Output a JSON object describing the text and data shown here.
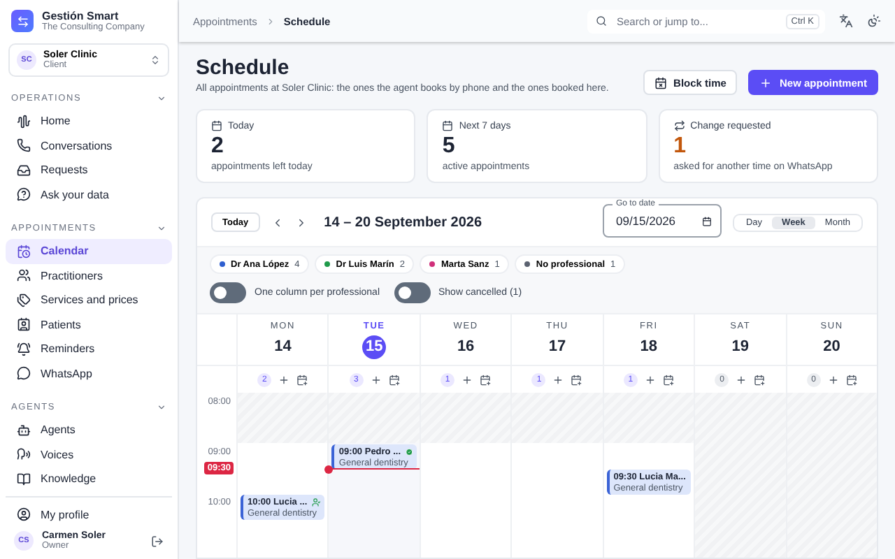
{
  "sidebar": {
    "brand": {
      "name": "Gestión Smart",
      "subtitle": "The Consulting Company"
    },
    "workspace": {
      "initials": "SC",
      "name": "Soler Clinic",
      "role": "Client"
    },
    "sections": [
      {
        "title": "OPERATIONS",
        "expanded": true,
        "items": [
          {
            "label": "Home",
            "selected": false
          },
          {
            "label": "Conversations",
            "selected": false
          },
          {
            "label": "Requests",
            "selected": false
          },
          {
            "label": "Ask your data",
            "selected": false
          }
        ]
      },
      {
        "title": "APPOINTMENTS",
        "expanded": true,
        "items": [
          {
            "label": "Calendar",
            "selected": true
          },
          {
            "label": "Practitioners",
            "selected": false
          },
          {
            "label": "Services and prices",
            "selected": false
          },
          {
            "label": "Patients",
            "selected": false
          },
          {
            "label": "Reminders",
            "selected": false
          },
          {
            "label": "WhatsApp",
            "selected": false
          }
        ]
      },
      {
        "title": "AGENTS",
        "expanded": true,
        "items": [
          {
            "label": "Agents",
            "selected": false
          },
          {
            "label": "Voices",
            "selected": false
          },
          {
            "label": "Knowledge",
            "selected": false
          }
        ]
      }
    ],
    "profile": "My profile",
    "user": {
      "initials": "CS",
      "name": "Carmen Soler",
      "role": "Owner"
    }
  },
  "topbar": {
    "breadcrumb": [
      "Appointments",
      "Schedule"
    ],
    "search": {
      "placeholder": "Search or jump to...",
      "shortcut": "Ctrl K"
    }
  },
  "header": {
    "title": "Schedule",
    "subtitle": "All appointments at Soler Clinic: the ones the agent books by phone and the ones booked here.",
    "buttons": [
      {
        "label": "Block time",
        "kind": "secondary"
      },
      {
        "label": "New appointment",
        "kind": "primary"
      }
    ]
  },
  "stats": [
    {
      "label": "Today",
      "value": "2",
      "caption": "appointments left today",
      "kind": "normal"
    },
    {
      "label": "Next 7 days",
      "value": "5",
      "caption": "active appointments",
      "kind": "normal"
    },
    {
      "label": "Change requested",
      "value": "1",
      "caption": "asked for another time on WhatsApp",
      "kind": "warning"
    }
  ],
  "calendar": {
    "today_button": "Today",
    "range": "14 – 20 September 2026",
    "date_field": {
      "label": "Go to date",
      "value": "09/15/2026"
    },
    "views": [
      {
        "label": "Day",
        "selected": false
      },
      {
        "label": "Week",
        "selected": true
      },
      {
        "label": "Month",
        "selected": false
      }
    ],
    "professionals": [
      {
        "name": "Dr Ana López",
        "count": "4",
        "color": "#2f5fd0"
      },
      {
        "name": "Dr Luis Marín",
        "count": "2",
        "color": "#1f9a4a"
      },
      {
        "name": "Marta Sanz",
        "count": "1",
        "color": "#d0307a"
      },
      {
        "name": "No professional",
        "count": "1",
        "color": "#5b6270"
      }
    ],
    "toggles": [
      {
        "label": "One column per professional",
        "on": false
      },
      {
        "label": "Show cancelled (1)",
        "on": false
      }
    ],
    "days": [
      {
        "weekday": "MON",
        "date": "14",
        "count": "2",
        "selected": false,
        "closed": false,
        "appointments": [
          {
            "time": "10:00",
            "name": "Lucia ...",
            "service": "General dentistry",
            "kind": "agent"
          }
        ]
      },
      {
        "weekday": "TUE",
        "date": "15",
        "count": "3",
        "selected": true,
        "closed": false,
        "appointments": [
          {
            "time": "09:00",
            "name": "Pedro ...",
            "service": "General dentistry",
            "kind": "confirmed"
          }
        ]
      },
      {
        "weekday": "WED",
        "date": "16",
        "count": "1",
        "selected": false,
        "closed": false
      },
      {
        "weekday": "THU",
        "date": "17",
        "count": "1",
        "selected": false,
        "closed": false
      },
      {
        "weekday": "FRI",
        "date": "18",
        "count": "1",
        "selected": false,
        "closed": false,
        "appointments": [
          {
            "time": "09:30",
            "name": "Lucia Ma...",
            "service": "General dentistry",
            "kind": "plain"
          }
        ]
      },
      {
        "weekday": "SAT",
        "date": "19",
        "count": "0",
        "selected": false,
        "closed": true
      },
      {
        "weekday": "SUN",
        "date": "20",
        "count": "0",
        "selected": false,
        "closed": true
      }
    ],
    "hours": [
      "08:00",
      "09:00",
      "10:00"
    ],
    "now": "09:30"
  }
}
